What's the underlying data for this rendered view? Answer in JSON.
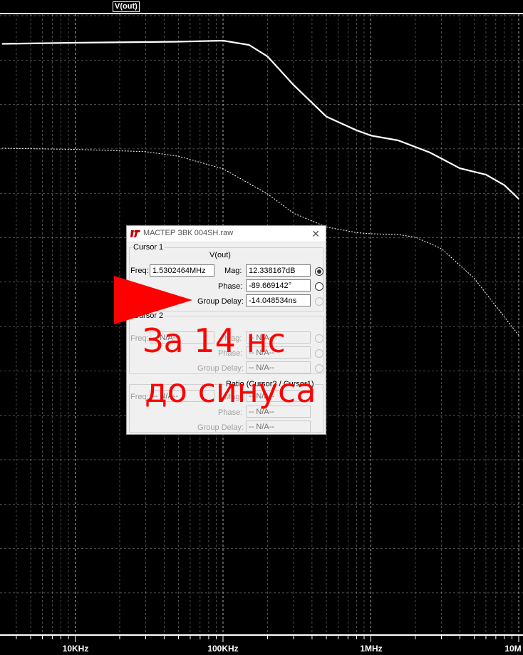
{
  "plot": {
    "trace_name": "V(out)",
    "background": "#000000",
    "grid_color": "#ffffff",
    "x_ticks": [
      {
        "label": "10KHz",
        "freq": 10000
      },
      {
        "label": "100KHz",
        "freq": 100000
      },
      {
        "label": "1MHz",
        "freq": 1000000
      },
      {
        "label": "10M",
        "freq": 10000000
      }
    ]
  },
  "chart_data": {
    "type": "line",
    "title": "",
    "xlabel": "",
    "ylabel": "",
    "x_scale": "log",
    "xlim": [
      3200,
      10000000
    ],
    "series": [
      {
        "name": "V(out)",
        "style": "solid",
        "x": [
          3200,
          10000,
          50000,
          100000,
          150000,
          200000,
          300000,
          500000,
          800000,
          1000000,
          1530000,
          2500000,
          4000000,
          6000000,
          8000000,
          10000000
        ],
        "y": [
          21.5,
          21.6,
          21.7,
          21.8,
          21.4,
          20.3,
          17.6,
          14.6,
          13.3,
          12.8,
          12.34,
          11.2,
          9.7,
          9.1,
          8.1,
          6.8
        ]
      },
      {
        "name": "Phase",
        "style": "dotted",
        "x": [
          3200,
          10000,
          30000,
          50000,
          100000,
          200000,
          300000,
          500000,
          800000,
          1000000,
          1530000,
          2000000,
          3000000,
          5000000,
          8000000,
          10000000
        ],
        "y": [
          -14,
          -15,
          -17,
          -21,
          -32,
          -54,
          -71,
          -83,
          -88,
          -89,
          -89.67,
          -92,
          -102,
          -128,
          -162,
          -178
        ]
      }
    ]
  },
  "dialog": {
    "title": "МАСТЕР ЗВК 004SH.raw",
    "close": "✕",
    "cursor1": {
      "group_label": "Cursor 1",
      "signal": "V(out)",
      "freq_label": "Freq:",
      "freq_value": "1.5302464MHz",
      "mag_label": "Mag:",
      "mag_value": "12.338167dB",
      "phase_label": "Phase:",
      "phase_value": "-89.669142°",
      "gd_label": "Group Delay:",
      "gd_value": "-14.048534ns"
    },
    "cursor2": {
      "group_label": "Cursor 2",
      "freq_label": "Freq:",
      "freq_value": "-- N/A--",
      "mag_label": "Mag:",
      "mag_value": "-- N/A--",
      "phase_label": "Phase:",
      "phase_value": "-- N/A--",
      "gd_label": "Group Delay:",
      "gd_value": "-- N/A--"
    },
    "ratio": {
      "group_label": "Ratio (Cursor2 / Cursor1)",
      "freq_label": "Freq:",
      "freq_value": "-- N/A--",
      "mag_label": "Mag:",
      "mag_value": "-- N/A--",
      "phase_label": "Phase:",
      "phase_value": "-- N/A--",
      "gd_label": "Group Delay:",
      "gd_value": "-- N/A--"
    }
  },
  "annotation": {
    "line1": "За 14 нс",
    "line2": "до синуса",
    "color": "#ff0000"
  }
}
